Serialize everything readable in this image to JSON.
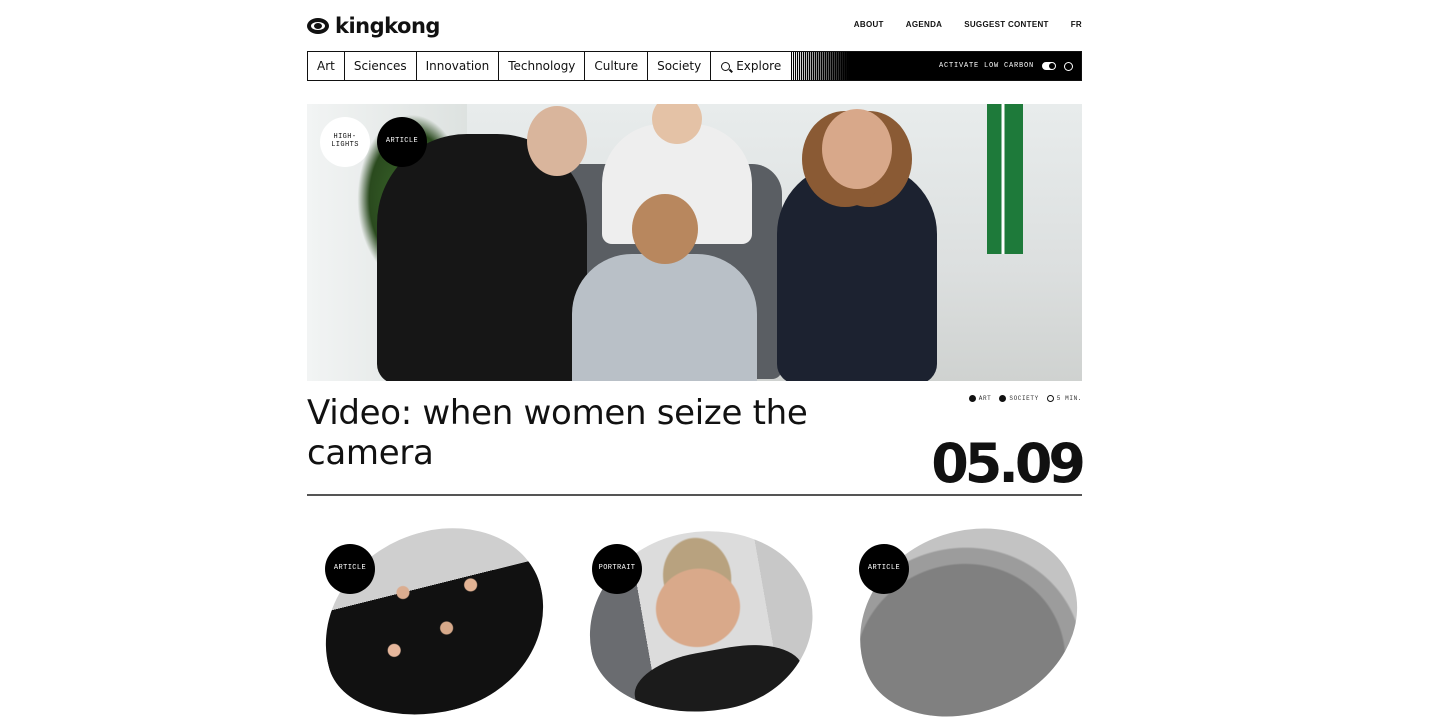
{
  "header": {
    "logo_text": "kingkong",
    "nav": [
      "ABOUT",
      "AGENDA",
      "SUGGEST CONTENT",
      "FR"
    ]
  },
  "categories": [
    "Art",
    "Sciences",
    "Innovation",
    "Technology",
    "Culture",
    "Society"
  ],
  "explore_label": "Explore",
  "low_carbon_label": "ACTIVATE LOW CARBON",
  "hero": {
    "badges": [
      "HIGH-\nLIGHTS",
      "ARTICLE"
    ],
    "tags": [
      "ART",
      "SOCIETY",
      "5 MIN."
    ],
    "headline": "Video: when women seize the camera",
    "date": "05.09"
  },
  "cards": [
    {
      "badge": "ARTICLE"
    },
    {
      "badge": "PORTRAIT"
    },
    {
      "badge": "ARTICLE"
    }
  ],
  "colors": {
    "ink": "#111111",
    "bar": "#000000",
    "background": "#ffffff"
  }
}
